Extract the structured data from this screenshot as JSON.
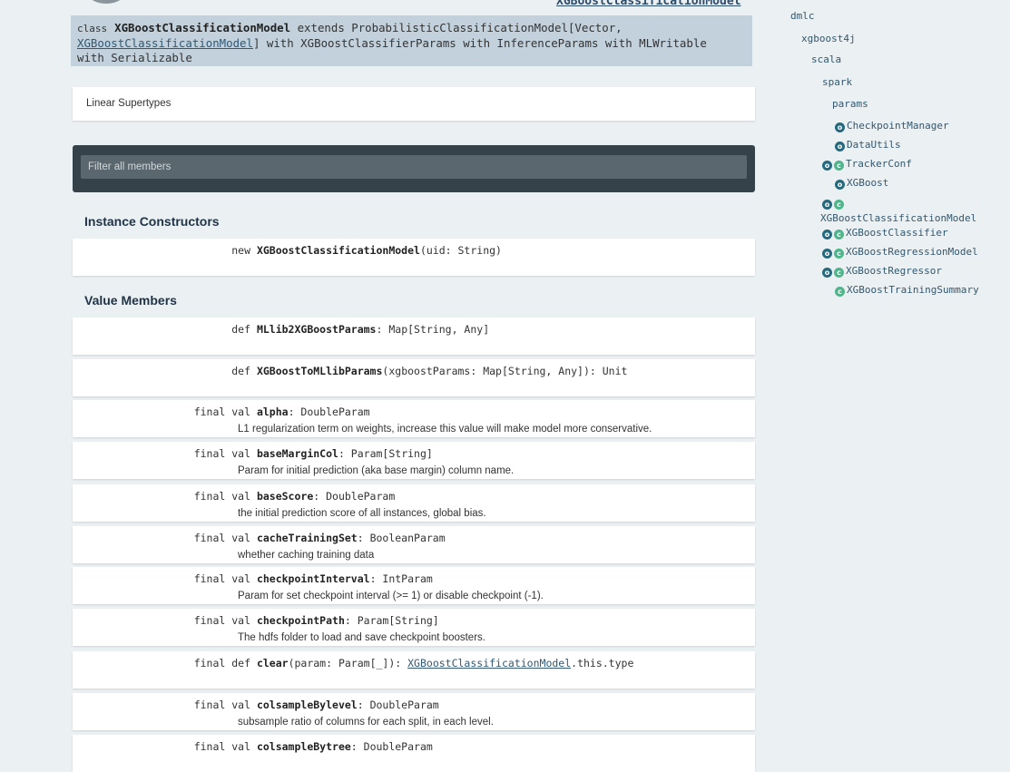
{
  "header": {
    "title": "XGBoostClassificationModel"
  },
  "signature": {
    "keyword": "class",
    "name": "XGBoostClassificationModel",
    "extends_text": "extends ProbabilisticClassificationModel[Vector,",
    "link": "XGBoostClassificationModel",
    "line2_rest": "] with XGBoostClassifierParams with InferenceParams with MLWritable",
    "line3": "with Serializable"
  },
  "supertypes": {
    "label": "Linear Supertypes"
  },
  "filter": {
    "placeholder": "Filter all members"
  },
  "constructors": {
    "title": "Instance Constructors",
    "items": [
      {
        "modifiers": "new",
        "name": "XGBoostClassificationModel",
        "signature": "(uid: String)"
      }
    ]
  },
  "value_members": {
    "title": "Value Members",
    "items": [
      {
        "modifiers": "def",
        "name": "MLlib2XGBoostParams",
        "signature": ": Map[String, Any]",
        "description": ""
      },
      {
        "modifiers": "def",
        "name": "XGBoostToMLlibParams",
        "signature": "(xgboostParams: Map[String, Any]): Unit",
        "description": ""
      },
      {
        "modifiers": "final val",
        "name": "alpha",
        "signature": ": DoubleParam",
        "description": "L1 regularization term on weights, increase this value will make model more conservative."
      },
      {
        "modifiers": "final val",
        "name": "baseMarginCol",
        "signature": ": Param[String]",
        "description": "Param for initial prediction (aka base margin) column name."
      },
      {
        "modifiers": "final val",
        "name": "baseScore",
        "signature": ": DoubleParam",
        "description": "the initial prediction score of all instances, global bias."
      },
      {
        "modifiers": "final val",
        "name": "cacheTrainingSet",
        "signature": ": BooleanParam",
        "description": "whether caching training data"
      },
      {
        "modifiers": "final val",
        "name": "checkpointInterval",
        "signature": ": IntParam",
        "description": "Param for set checkpoint interval (>= 1) or disable checkpoint (-1)."
      },
      {
        "modifiers": "final val",
        "name": "checkpointPath",
        "signature": ": Param[String]",
        "description": "The hdfs folder to load and save checkpoint boosters."
      },
      {
        "modifiers": "final def",
        "name": "clear",
        "signature_pre": "(param: Param[_]): ",
        "link": "XGBoostClassificationModel",
        "signature_post": ".this.type",
        "description": ""
      },
      {
        "modifiers": "final val",
        "name": "colsampleBylevel",
        "signature": ": DoubleParam",
        "description": "subsample ratio of columns for each split, in each level."
      },
      {
        "modifiers": "final val",
        "name": "colsampleBytree",
        "signature": ": DoubleParam",
        "description": ""
      }
    ]
  },
  "sidebar": {
    "packages": [
      "dmlc",
      "xgboost4j",
      "scala",
      "spark",
      "params"
    ],
    "entries": [
      {
        "badges": [
          "o"
        ],
        "label": "CheckpointManager"
      },
      {
        "badges": [
          "o"
        ],
        "label": "DataUtils"
      },
      {
        "badges": [
          "o",
          "c"
        ],
        "label": "TrackerConf"
      },
      {
        "badges": [
          "o"
        ],
        "label": "XGBoost"
      },
      {
        "badges": [
          "o",
          "c"
        ],
        "label": "XGBoostClassificationModel"
      },
      {
        "badges": [
          "o",
          "c"
        ],
        "label": "XGBoostClassifier"
      },
      {
        "badges": [
          "o",
          "c"
        ],
        "label": "XGBoostRegressionModel"
      },
      {
        "badges": [
          "o",
          "c"
        ],
        "label": "XGBoostRegressor"
      },
      {
        "badges": [
          "c"
        ],
        "label": "XGBoostTrainingSummary"
      }
    ]
  },
  "colors": {
    "background": "#ebf0f2",
    "signature_bg": "#c2d1dc",
    "filter_bg": "#364249",
    "object_badge": "#26697d",
    "class_badge": "#4fb58a"
  }
}
